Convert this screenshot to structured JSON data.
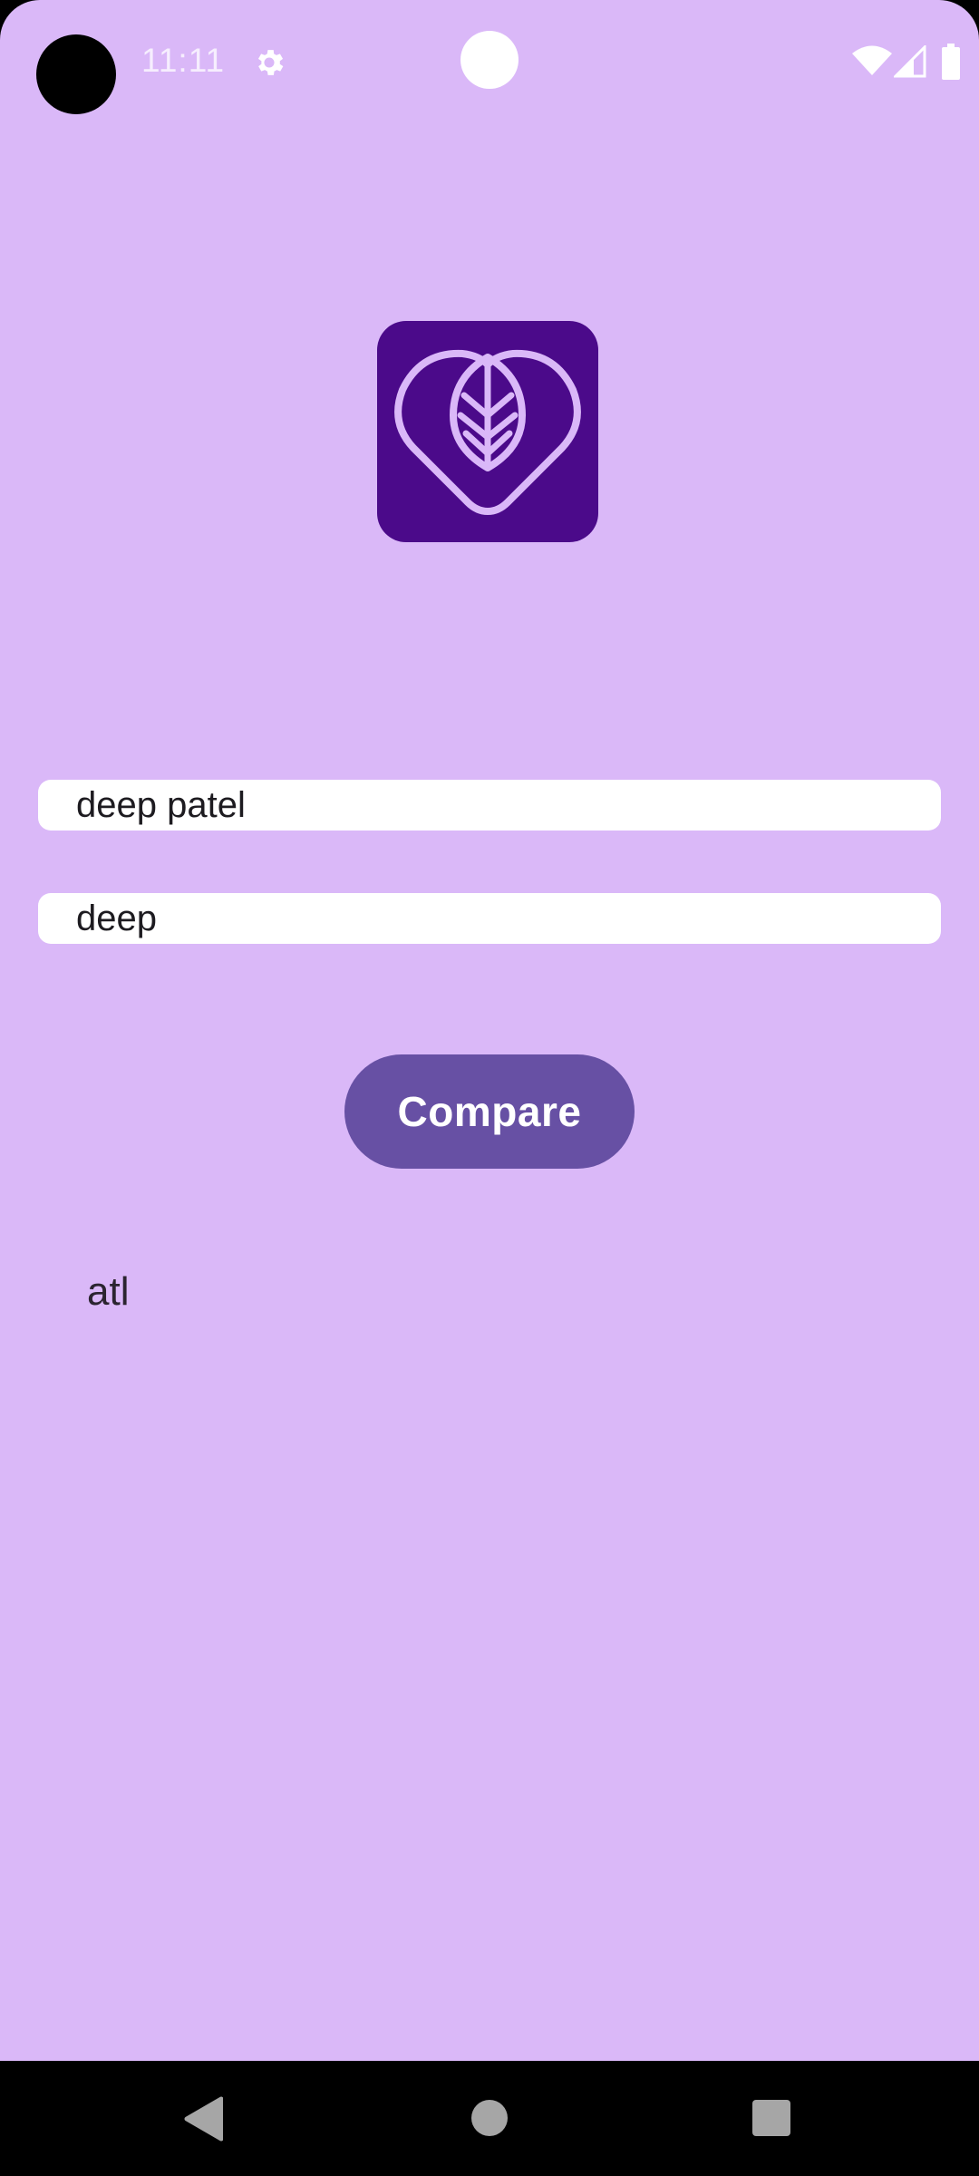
{
  "status_bar": {
    "time": "11:11",
    "icons": [
      "settings-icon",
      "wifi-icon",
      "cell-signal-icon",
      "battery-icon"
    ]
  },
  "logo": {
    "icon": "heart-leaf-logo-icon",
    "background_color": "#4b0a8a",
    "stroke_color": "#dab8f8"
  },
  "form": {
    "first_field_value": "deep patel",
    "second_field_value": "deep"
  },
  "compare_button": {
    "label": "Compare",
    "color": "#6750a4"
  },
  "result": {
    "text": "atl"
  },
  "navigation_bar": {
    "icons": [
      "back-icon",
      "home-icon",
      "recents-icon"
    ]
  },
  "colors": {
    "app_background": "#dab8f8",
    "field_background": "#ffffff"
  }
}
